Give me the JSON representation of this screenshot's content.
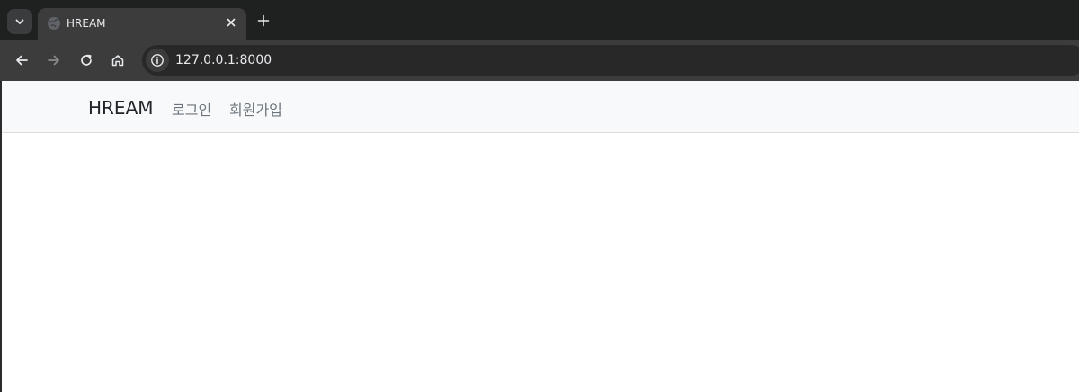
{
  "browser": {
    "tab": {
      "title": "HREAM"
    },
    "address_bar": {
      "url": "127.0.0.1:8000"
    }
  },
  "page": {
    "navbar": {
      "brand": "HREAM",
      "links": [
        {
          "label": "로그인"
        },
        {
          "label": "회원가입"
        }
      ]
    }
  }
}
